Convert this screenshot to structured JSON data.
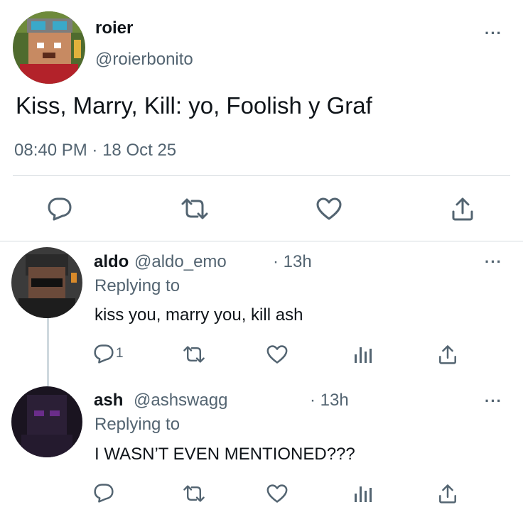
{
  "main_tweet": {
    "author_name": "roier",
    "author_handle": "@roierbonito",
    "text": "Kiss, Marry, Kill: yo, Foolish y Graf",
    "time": "08:40 PM",
    "separator": "·",
    "date": "18 Oct 25",
    "more_label": "···"
  },
  "replies": [
    {
      "author_name": "aldo",
      "author_handle": "@aldo_emo",
      "time": "· 13h",
      "replying_to": "Replying to",
      "text": "kiss you, marry you, kill ash",
      "reply_count": "1",
      "more_label": "···"
    },
    {
      "author_name": "ash",
      "author_handle": "@ashswagg",
      "time": "· 13h",
      "replying_to": "Replying to",
      "text": "I WASN’T EVEN MENTIONED???",
      "reply_count": "",
      "more_label": "···"
    }
  ],
  "icons": {
    "reply": "reply-icon",
    "retweet": "retweet-icon",
    "like": "heart-icon",
    "views": "analytics-icon",
    "share": "share-icon"
  },
  "colors": {
    "text_primary": "#0f1419",
    "text_secondary": "#536471",
    "divider": "#d6dbdf"
  }
}
